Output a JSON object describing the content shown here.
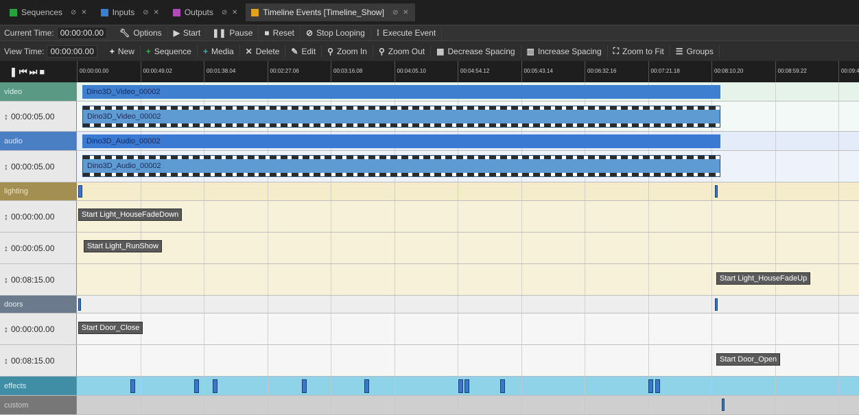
{
  "tabs": [
    {
      "label": "Sequences",
      "color": "#27a23a"
    },
    {
      "label": "Inputs",
      "color": "#3a7fd0"
    },
    {
      "label": "Outputs",
      "color": "#b24ab9"
    },
    {
      "label": "Timeline Events [Timeline_Show]",
      "color": "#e3a21e"
    }
  ],
  "event_toolbar": {
    "current_time_label": "Current Time:",
    "current_time_value": "00:00:00.00",
    "options": "Options",
    "start": "Start",
    "pause": "Pause",
    "reset": "Reset",
    "stop_looping": "Stop Looping",
    "execute_event": "Execute Event"
  },
  "view_toolbar": {
    "view_time_label": "View Time:",
    "view_time_value": "00:00:00.00",
    "new": "New",
    "sequence": "Sequence",
    "media": "Media",
    "delete": "Delete",
    "edit": "Edit",
    "zoom_in": "Zoom In",
    "zoom_out": "Zoom Out",
    "decrease_spacing": "Decrease Spacing",
    "increase_spacing": "Increase Spacing",
    "zoom_to_fit": "Zoom to Fit",
    "groups": "Groups"
  },
  "ruler_ticks": [
    "00:00:00.00",
    "00:00:49.02",
    "00:01:38.04",
    "00:02:27.06",
    "00:03:16.08",
    "00:04:05.10",
    "00:04:54.12",
    "00:05:43.14",
    "00:06:32.16",
    "00:07:21.18",
    "00:08:10.20",
    "00:08:59.22",
    "00:09:4"
  ],
  "tracks": {
    "video": {
      "name": "video",
      "clip": "Dino3D_Video_00002",
      "time": "00:00:05.00",
      "event": "Dino3D_Video_00002"
    },
    "audio": {
      "name": "audio",
      "clip": "Dino3D_Audio_00002",
      "time": "00:00:05.00",
      "event": "Dino3D_Audio_00002"
    },
    "lighting": {
      "name": "lighting",
      "events": [
        {
          "time": "00:00:00.00",
          "label": "Start Light_HouseFadeDown"
        },
        {
          "time": "00:00:05.00",
          "label": "Start Light_RunShow"
        },
        {
          "time": "00:08:15.00",
          "label": "Start Light_HouseFadeUp"
        }
      ]
    },
    "doors": {
      "name": "doors",
      "events": [
        {
          "time": "00:00:00.00",
          "label": "Start Door_Close"
        },
        {
          "time": "00:08:15.00",
          "label": "Start Door_Open"
        }
      ]
    },
    "effects": {
      "name": "effects"
    },
    "custom": {
      "name": "custom"
    }
  },
  "colors": {
    "video": "#e5f3ea",
    "video_header": "#5a9a85",
    "audio": "#e3ecf8",
    "audio_header": "#4b7fc4",
    "lighting": "#f4eccb",
    "lighting_header": "#a38f52",
    "doors": "#eeeeee",
    "doors_header": "#6b7a8c",
    "effects": "#8fd3e8",
    "effects_header": "#3f8ea6",
    "custom": "#cfcfcf",
    "custom_header": "#777777"
  }
}
